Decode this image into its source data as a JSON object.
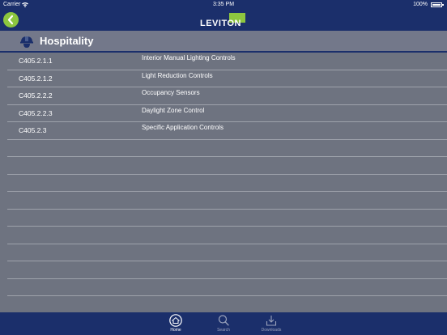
{
  "status_bar": {
    "carrier": "Carrier",
    "time": "3:35 PM",
    "battery": "100%"
  },
  "nav": {
    "logo_text": "LEVITON",
    "accent_color": "#8dc63f",
    "bar_color": "#1b2f6b"
  },
  "section": {
    "title": "Hospitality",
    "icon": "hard-hat-icon"
  },
  "rows": [
    {
      "code": "C405.2.1.1",
      "name": "Interior Manual Lighting Controls"
    },
    {
      "code": "C405.2.1.2",
      "name": "Light Reduction Controls"
    },
    {
      "code": "C405.2.2.2",
      "name": "Occupancy Sensors"
    },
    {
      "code": "C405.2.2.3",
      "name": "Daylight Zone Control"
    },
    {
      "code": "C405.2.3",
      "name": "Specific Application Controls"
    },
    {
      "code": "",
      "name": ""
    },
    {
      "code": "",
      "name": ""
    },
    {
      "code": "",
      "name": ""
    },
    {
      "code": "",
      "name": ""
    },
    {
      "code": "",
      "name": ""
    },
    {
      "code": "",
      "name": ""
    },
    {
      "code": "",
      "name": ""
    },
    {
      "code": "",
      "name": ""
    },
    {
      "code": "",
      "name": ""
    },
    {
      "code": "",
      "name": ""
    }
  ],
  "tabs": [
    {
      "label": "Home",
      "icon": "home-icon",
      "active": true
    },
    {
      "label": "Search",
      "icon": "search-icon",
      "active": false
    },
    {
      "label": "Downloads",
      "icon": "download-icon",
      "active": false
    }
  ]
}
